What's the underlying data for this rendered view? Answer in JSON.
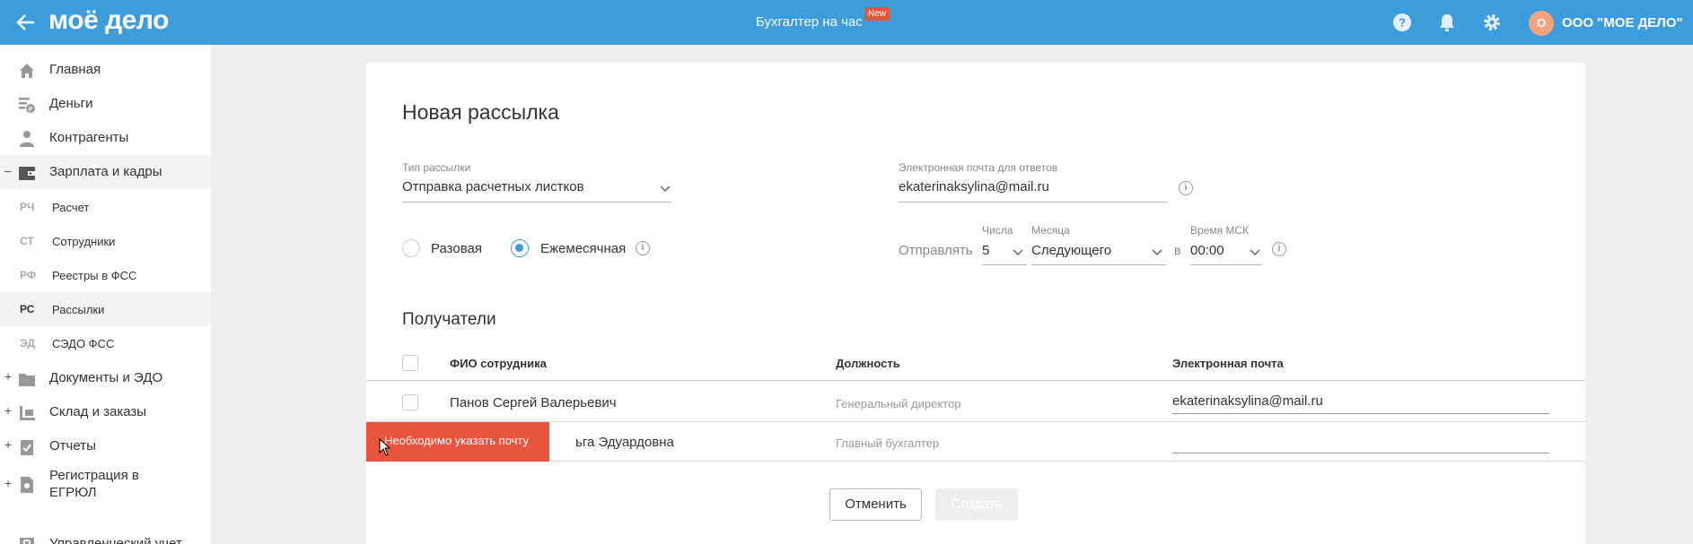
{
  "header": {
    "logo": "моё дело",
    "center_title": "Бухгалтер на час",
    "new_badge": "New",
    "avatar_letter": "О",
    "company": "ООО \"МОЕ ДЕЛО\"",
    "icons": [
      "back-arrow-icon",
      "help-icon",
      "bell-icon",
      "gear-icon"
    ]
  },
  "sidebar": {
    "items": [
      {
        "label": "Главная",
        "icon": "home-icon"
      },
      {
        "label": "Деньги",
        "icon": "money-icon"
      },
      {
        "label": "Контрагенты",
        "icon": "contractors-icon"
      },
      {
        "label": "Зарплата и кадры",
        "icon": "wallet-icon",
        "toggle": "–"
      }
    ],
    "subitems": [
      {
        "abbr": "РЧ",
        "label": "Расчет"
      },
      {
        "abbr": "СТ",
        "label": "Сотрудники"
      },
      {
        "abbr": "РФ",
        "label": "Реестры в ФСС"
      },
      {
        "abbr": "РС",
        "label": "Рассылки"
      },
      {
        "abbr": "ЭД",
        "label": "СЭДО ФСС"
      }
    ],
    "items2": [
      {
        "label": "Документы и ЭДО",
        "icon": "folder-icon",
        "toggle": "+"
      },
      {
        "label": "Склад и заказы",
        "icon": "warehouse-icon",
        "toggle": "+"
      },
      {
        "label": "Отчеты",
        "icon": "reports-icon",
        "toggle": "+"
      },
      {
        "label": "Регистрация в",
        "label2": "ЕГРЮЛ",
        "icon": "registration-icon",
        "toggle": "+"
      },
      {
        "label": "Управленческий учет",
        "icon": "management-icon"
      }
    ]
  },
  "form": {
    "title": "Новая рассылка",
    "type_label": "Тип рассылки",
    "type_value": "Отправка расчетных листков",
    "reply_email_label": "Электронная почта для ответов",
    "reply_email_value": "ekaterinaksylina@mail.ru",
    "radio_once": "Разовая",
    "radio_monthly": "Ежемесячная",
    "send_label": "Отправлять",
    "day_label": "Числа",
    "day_value": "5",
    "month_label": "Месяца",
    "month_value": "Следующего",
    "at_label": "в",
    "time_label": "Время МСК",
    "time_value": "00:00"
  },
  "recipients": {
    "title": "Получатели",
    "columns": [
      "ФИО сотрудника",
      "Должность",
      "Электронная почта"
    ],
    "rows": [
      {
        "name": "Панов Сергей Валерьевич",
        "position": "Генеральный директор",
        "email": "ekaterinaksylina@mail.ru"
      },
      {
        "name": "ьга Эдуардовна",
        "position": "Главный бухгалтер",
        "email": ""
      }
    ]
  },
  "buttons": {
    "cancel": "Отменить",
    "create": "Создать"
  },
  "tooltip": "Необходимо указать почту",
  "colors": {
    "header": "#3d9cdc",
    "accent": "#3d9cdc",
    "error": "#e8553e"
  }
}
